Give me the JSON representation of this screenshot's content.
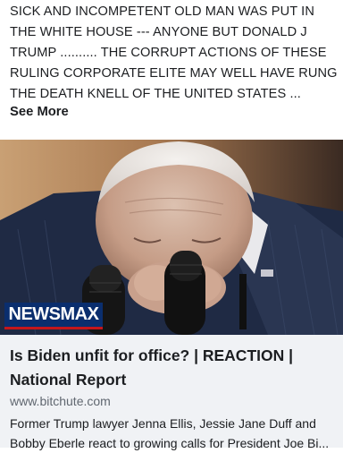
{
  "post": {
    "text_lines": [
      "SICK AND INCOMPETENT OLD MAN WAS PUT IN",
      "THE WHITE HOUSE  --- ANYONE BUT DONALD J",
      "TRUMP  .......... THE CORRUPT ACTIONS OF THESE",
      "RULING CORPORATE ELITE MAY WELL HAVE RUNG",
      "THE DEATH KNELL OF THE UNITED STATES ..."
    ],
    "see_more_label": "See More"
  },
  "media": {
    "logo_text": "NEWSMAX",
    "logo_colors": {
      "background": "#0a2e6e",
      "stripe": "#c4161c"
    }
  },
  "link_preview": {
    "title_line1": "Is Biden unfit for office? | REACTION |",
    "title_line2": "National Report",
    "domain": "www.bitchute.com",
    "description_line1": "Former Trump lawyer Jenna Ellis, Jessie Jane Duff and",
    "description_line2": "Bobby Eberle react to growing calls for President Joe Bi..."
  }
}
